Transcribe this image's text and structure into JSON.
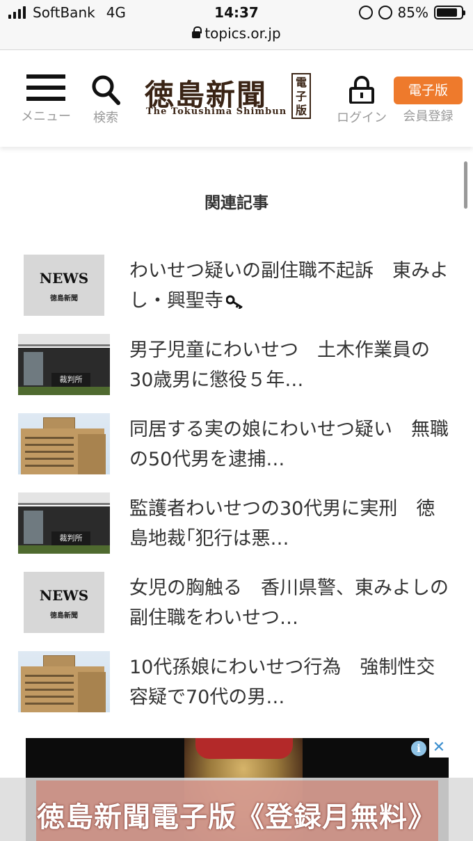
{
  "status_bar": {
    "carrier": "SoftBank",
    "network": "4G",
    "time": "14:37",
    "battery": "85%",
    "battery_level": 0.85,
    "url": "topics.or.jp"
  },
  "header": {
    "menu_label": "メニュー",
    "search_label": "検索",
    "logo_title": "徳島新聞",
    "logo_subtitle": "The Tokushima Shimbun",
    "logo_edition": "電子版",
    "login_label": "ログイン",
    "edition_button": "電子版",
    "register_label": "会員登録",
    "accent_color": "#ee7a2c"
  },
  "section_title": "関連記事",
  "articles": [
    {
      "title": "わいせつ疑いの副住職不起訴　東みよし・興聖寺",
      "thumb": "news",
      "members_only": true
    },
    {
      "title": "男子児童にわいせつ　土木作業員の30歳男に懲役５年…",
      "thumb": "court",
      "members_only": false
    },
    {
      "title": "同居する実の娘にわいせつ疑い　無職の50代男を逮捕…",
      "thumb": "police",
      "members_only": false
    },
    {
      "title": "監護者わいせつの30代男に実刑　徳島地裁｢犯行は悪…",
      "thumb": "court",
      "members_only": false
    },
    {
      "title": "女児の胸触る　香川県警、東みよしの副住職をわいせつ…",
      "thumb": "news",
      "members_only": false
    },
    {
      "title": "10代孫娘にわいせつ行為　強制性交容疑で70代の男…",
      "thumb": "police",
      "members_only": false
    }
  ],
  "thumb_text": {
    "news_word": "NEWS",
    "news_sub": "徳島新聞",
    "court_sign": "裁判所"
  },
  "ad": {
    "info": "i",
    "close": "✕"
  },
  "banner_text": "徳島新聞電子版《登録月無料》"
}
